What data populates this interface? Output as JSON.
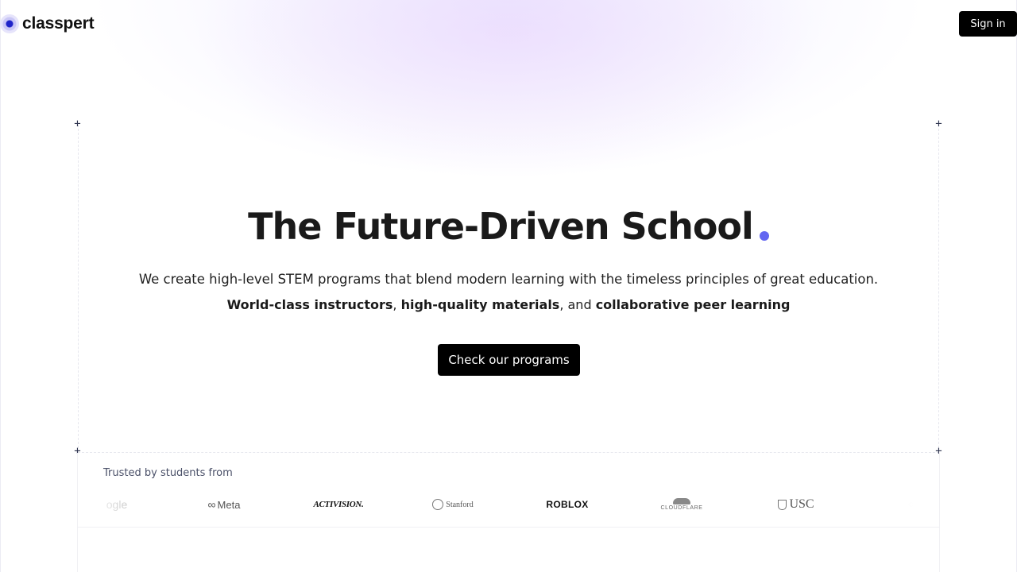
{
  "header": {
    "brand": "classpert",
    "signin_label": "Sign in"
  },
  "hero": {
    "title": "The Future-Driven School",
    "subtitle": "We create high-level STEM programs that blend modern learning with the timeless principles of great education.",
    "highlight_1": "World-class instructors",
    "sep_1": ", ",
    "highlight_2": "high-quality materials",
    "sep_2": ", and ",
    "highlight_3": "collaborative peer learning",
    "cta_label": "Check our programs"
  },
  "trusted": {
    "label": "Trusted by students from",
    "logos": [
      "ogle",
      "Meta",
      "ACTIVISION.",
      "Stanford",
      "ROBLOX",
      "CLOUDFLARE",
      "USC"
    ]
  },
  "colors": {
    "accent_dot": "#6366f1",
    "button_bg": "#000000",
    "logo_mark": "#1f24c9"
  },
  "icons": {
    "brand_mark": "concentric-circle-logo-icon",
    "corner_markers": "plus-icon"
  }
}
